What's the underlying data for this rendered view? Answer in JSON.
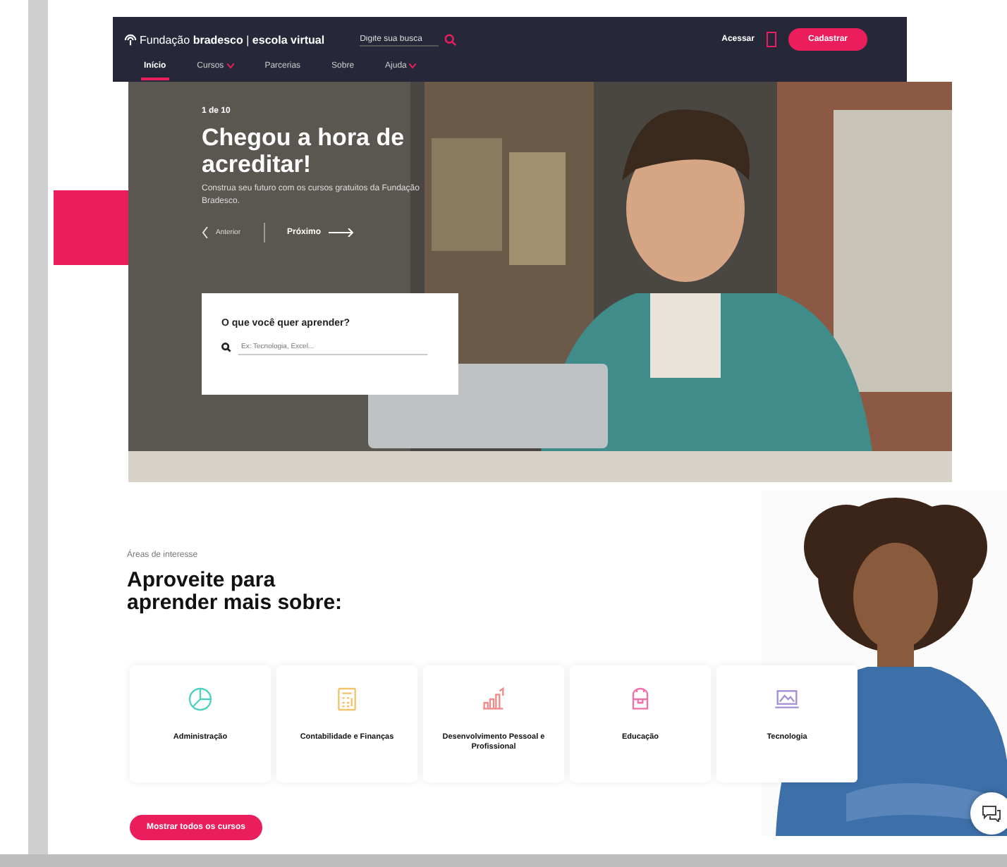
{
  "nav": {
    "logo": "Fundação **bradesco** | **escola virtual**",
    "search_placeholder": "Digite sua busca",
    "login": "Acessar",
    "signup": "Cadastrar",
    "menu": [
      {
        "label": "Início",
        "selected": true,
        "dropdown": false
      },
      {
        "label": "Cursos",
        "selected": false,
        "dropdown": true
      },
      {
        "label": "Parcerias",
        "selected": false,
        "dropdown": false
      },
      {
        "label": "Sobre",
        "selected": false,
        "dropdown": false
      },
      {
        "label": "Ajuda",
        "selected": false,
        "dropdown": true
      }
    ]
  },
  "hero": {
    "counter": "1 de 10",
    "title": "Chegou a hora de acreditar!",
    "subtitle": "Construa seu futuro com os cursos gratuitos da Fundação Bradesco.",
    "prev": "Anterior",
    "next": "Próximo",
    "search": {
      "label": "O que você quer aprender?",
      "placeholder": "Ex: Tecnologia, Excel..."
    }
  },
  "interests": {
    "eyebrow": "Áreas de interesse",
    "heading": "Aproveite para aprender mais sobre:",
    "cards": [
      {
        "label": "Administração",
        "kind": "pie"
      },
      {
        "label": "Contabilidade e Finanças",
        "kind": "calculator"
      },
      {
        "label": "Desenvolvimento Pessoal e Profissional",
        "kind": "growth"
      },
      {
        "label": "Educação",
        "kind": "backpack"
      },
      {
        "label": "Tecnologia",
        "kind": "laptop"
      }
    ],
    "show_all": "Mostrar todos os cursos"
  }
}
